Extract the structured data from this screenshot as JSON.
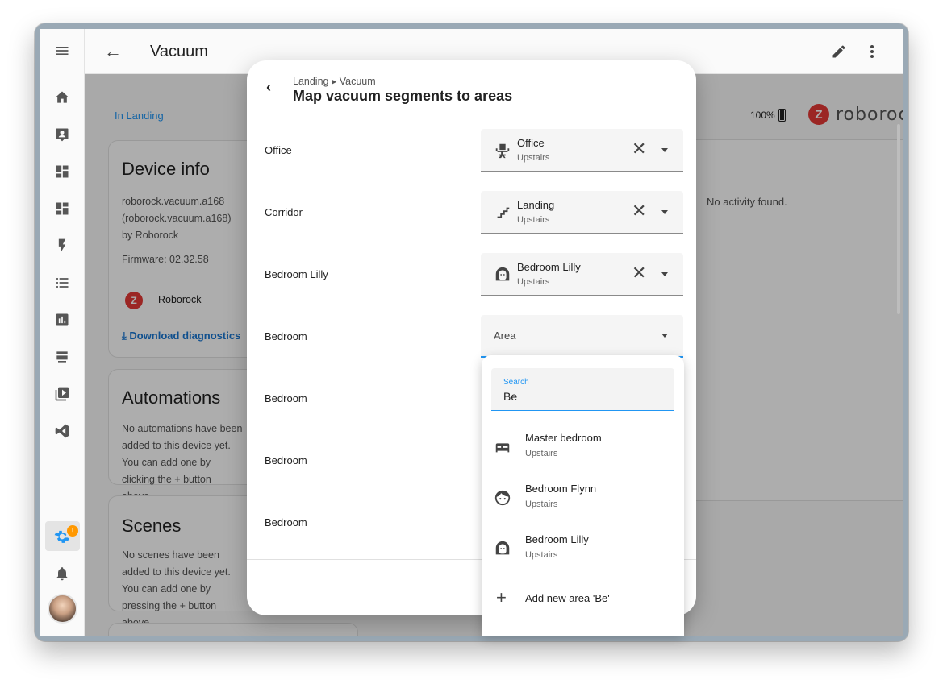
{
  "header": {
    "title": "Vacuum"
  },
  "breadcrumb": {
    "area_link": "In Landing"
  },
  "device_info": {
    "title": "Device info",
    "model": "roborock.vacuum.a168",
    "model_paren": "(roborock.vacuum.a168)",
    "by": "by Roborock",
    "firmware": "Firmware: 02.32.58",
    "integration": "Roborock",
    "download": "Download diagnostics"
  },
  "automations": {
    "title": "Automations",
    "text": "No automations have been added to this device yet. You can add one by clicking the + button above."
  },
  "scenes": {
    "title": "Scenes",
    "text": "No scenes have been added to this device yet. You can add one by pressing the + button above."
  },
  "status": {
    "battery": "100%",
    "activity": "No activity found.",
    "brand": "roborock"
  },
  "dialog": {
    "crumb": "Landing ▸ Vacuum",
    "title": "Map vacuum segments to areas",
    "rows": [
      {
        "segment": "Office",
        "area": "Office",
        "floor": "Upstairs",
        "icon": "office-chair-icon"
      },
      {
        "segment": "Corridor",
        "area": "Landing",
        "floor": "Upstairs",
        "icon": "stairs-icon"
      },
      {
        "segment": "Bedroom Lilly",
        "area": "Bedroom Lilly",
        "floor": "Upstairs",
        "icon": "face-woman-icon"
      },
      {
        "segment": "Bedroom",
        "placeholder": "Area"
      },
      {
        "segment": "Bedroom"
      },
      {
        "segment": "Bedroom"
      },
      {
        "segment": "Bedroom"
      }
    ]
  },
  "dropdown": {
    "search_label": "Search",
    "search_value": "Be",
    "options": [
      {
        "name": "Master bedroom",
        "floor": "Upstairs",
        "icon": "bed-icon"
      },
      {
        "name": "Bedroom Flynn",
        "floor": "Upstairs",
        "icon": "face-man-icon"
      },
      {
        "name": "Bedroom Lilly",
        "floor": "Upstairs",
        "icon": "face-woman-icon"
      }
    ],
    "add_new": "Add new area 'Be'"
  },
  "colors": {
    "accent": "#2196f3",
    "brand": "#e53935",
    "badge": "#ff9800"
  }
}
